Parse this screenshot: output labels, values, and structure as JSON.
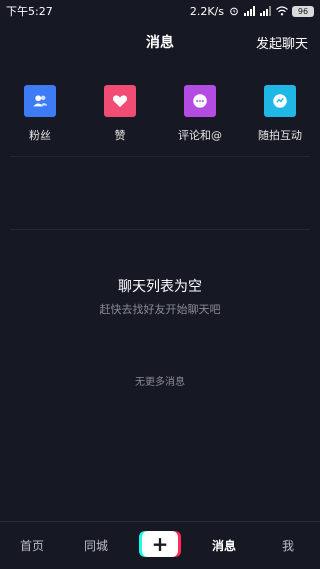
{
  "status_bar": {
    "time": "下午5:27",
    "speed": "2.2K/s",
    "battery": "96"
  },
  "header": {
    "title": "消息",
    "action": "发起聊天"
  },
  "shortcuts": [
    {
      "label": "粉丝",
      "icon": "fans-icon",
      "color": "#3d7cf5"
    },
    {
      "label": "赞",
      "icon": "heart-icon",
      "color": "#f04c74"
    },
    {
      "label": "评论和@",
      "icon": "comment-icon",
      "color": "#b44ce3"
    },
    {
      "label": "随拍互动",
      "icon": "camera-interact-icon",
      "color": "#1fb8e6"
    }
  ],
  "empty_state": {
    "title": "聊天列表为空",
    "subtitle": "赶快去找好友开始聊天吧",
    "no_more": "无更多消息"
  },
  "bottom_nav": {
    "items": [
      "首页",
      "同城",
      "消息",
      "我"
    ],
    "active": "消息",
    "plus": "+"
  }
}
